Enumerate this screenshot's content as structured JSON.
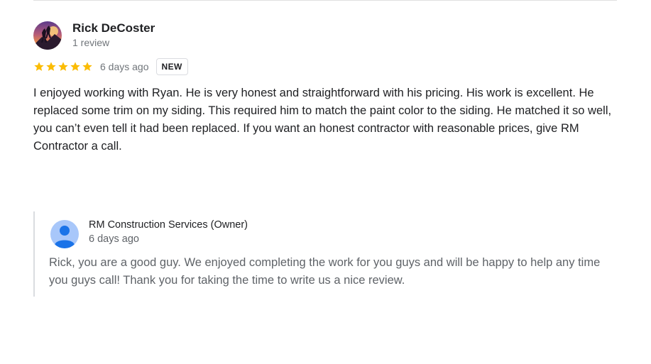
{
  "review": {
    "reviewer_name": "Rick DeCoster",
    "review_count": "1 review",
    "rating": 5,
    "max_rating": 5,
    "date": "6 days ago",
    "badge": "NEW",
    "text": "I enjoyed working with Ryan. He is very honest and straightforward with his pricing. His work is excellent. He replaced some trim on my siding. This required him to match the paint color to the siding. He matched it so well, you can’t even tell it had been replaced. If you want an honest contractor with reasonable prices, give RM Contractor a call."
  },
  "reply": {
    "owner_name": "RM Construction Services (Owner)",
    "date": "6 days ago",
    "text": "Rick, you are a good guy. We enjoyed completing the work for you guys and will be happy to help any time you guys call! Thank you for taking the time to write us a nice review."
  },
  "colors": {
    "star": "#fbbc04",
    "owner_avatar_bg": "#a8c7fa",
    "owner_avatar_fg": "#1a73e8"
  },
  "icons": {
    "reviewer_avatar": "user-photo-avatar",
    "star": "star-icon",
    "owner_avatar": "person-icon"
  }
}
